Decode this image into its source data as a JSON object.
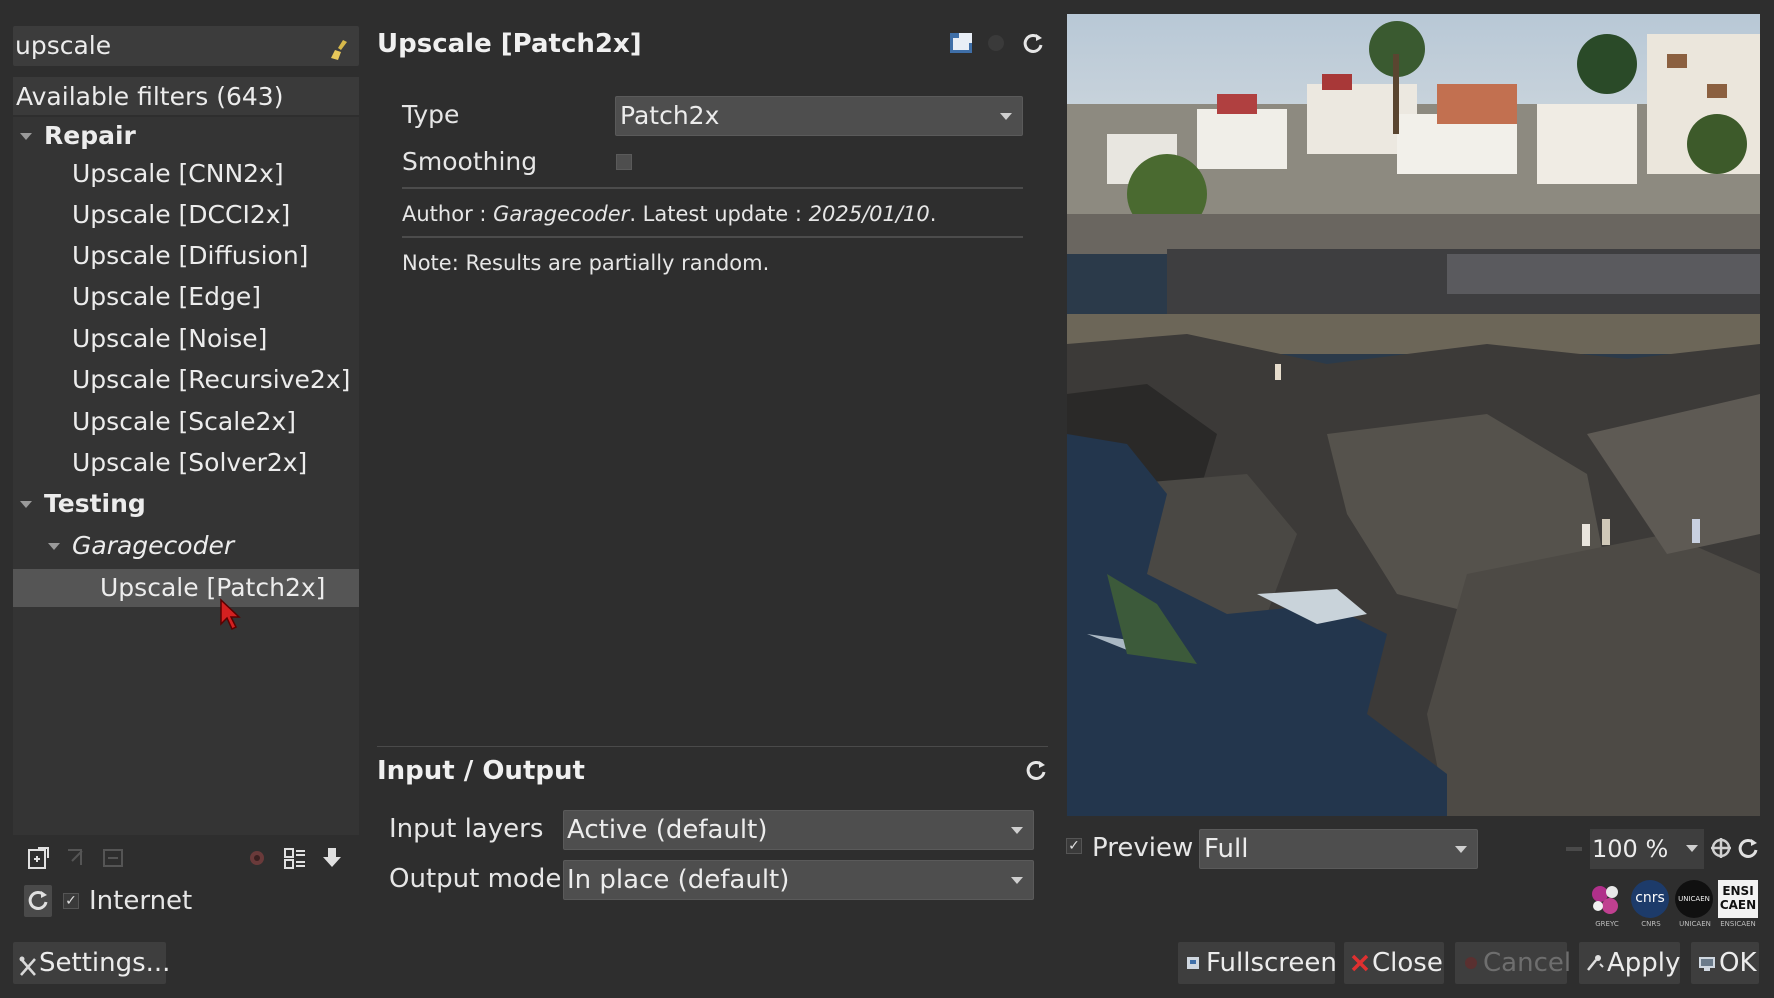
{
  "search": {
    "value": "upscale"
  },
  "filters": {
    "header": "Available filters (643)",
    "tree": [
      {
        "label": "Repair",
        "kind": "category"
      },
      {
        "label": "Upscale [CNN2x]",
        "kind": "filter"
      },
      {
        "label": "Upscale [DCCI2x]",
        "kind": "filter"
      },
      {
        "label": "Upscale [Diffusion]",
        "kind": "filter"
      },
      {
        "label": "Upscale [Edge]",
        "kind": "filter"
      },
      {
        "label": "Upscale [Noise]",
        "kind": "filter"
      },
      {
        "label": "Upscale [Recursive2x]",
        "kind": "filter"
      },
      {
        "label": "Upscale [Scale2x]",
        "kind": "filter"
      },
      {
        "label": "Upscale [Solver2x]",
        "kind": "filter"
      },
      {
        "label": "Testing",
        "kind": "category"
      },
      {
        "label": "Garagecoder",
        "kind": "subcategory"
      },
      {
        "label": "Upscale [Patch2x]",
        "kind": "filter",
        "selected": true
      }
    ],
    "internet_label": "Internet",
    "internet_checked": true
  },
  "settings_button": "Settings...",
  "filter": {
    "title": "Upscale [Patch2x]",
    "params": {
      "type_label": "Type",
      "type_value": "Patch2x",
      "smoothing_label": "Smoothing",
      "smoothing_checked": false
    },
    "author_prefix": "Author : ",
    "author_name": "Garagecoder",
    "update_prefix": ". Latest update : ",
    "update_date": "2025/01/10",
    "update_suffix": ".",
    "note": "Note: Results are partially random."
  },
  "io": {
    "title": "Input / Output",
    "input_label": "Input layers",
    "input_value": "Active (default)",
    "output_label": "Output mode",
    "output_value": "In place (default)"
  },
  "preview": {
    "label": "Preview",
    "checked": true,
    "mode": "Full",
    "zoom": "100 %"
  },
  "logos": [
    {
      "text": "GREYC"
    },
    {
      "text": "CNRS"
    },
    {
      "text": "UNICAEN"
    },
    {
      "text": "ENSICAEN"
    }
  ],
  "logo_marks": {
    "cnrs": "cnrs",
    "unicaen": "UNICAEN",
    "ensi": "ENSI",
    "caen": "CAEN"
  },
  "buttons": {
    "fullscreen": "Fullscreen",
    "close": "Close",
    "cancel": "Cancel",
    "apply": "Apply",
    "ok": "OK"
  },
  "colors": {
    "background": "#2e2e2e",
    "panel": "#343434",
    "selected_row": "#555555",
    "close_icon": "#e03030"
  }
}
